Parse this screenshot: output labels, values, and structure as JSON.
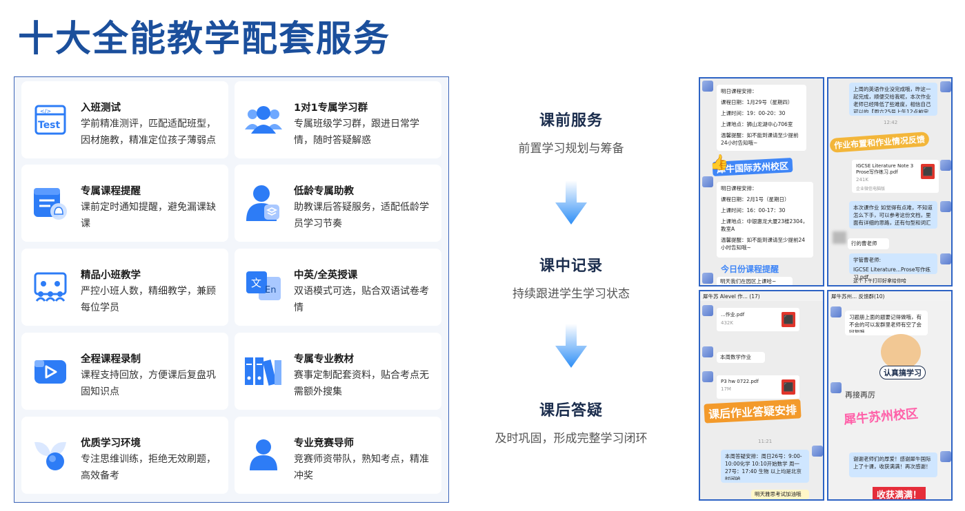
{
  "title": "十大全能教学配套服务",
  "services": [
    {
      "title": "入班测试",
      "desc": "学前精准测评，匹配适配班型，因材施教，精准定位孩子薄弱点",
      "icon": "test-icon"
    },
    {
      "title": "1对1专属学习群",
      "desc": "专属班级学习群，跟进日常学情，随时答疑解惑",
      "icon": "group-users-icon"
    },
    {
      "title": "专属课程提醒",
      "desc": "课前定时通知提醒，避免漏课缺课",
      "icon": "notification-bell-icon"
    },
    {
      "title": "低龄专属助教",
      "desc": "助教课后答疑服务，适配低龄学员学习节奏",
      "icon": "assistant-teacher-icon"
    },
    {
      "title": "精品小班教学",
      "desc": "严控小班人数，精细教学，兼顾每位学员",
      "icon": "small-class-icon"
    },
    {
      "title": "中英/全英授课",
      "desc": "双语模式可选，贴合双语试卷考情",
      "icon": "translate-icon"
    },
    {
      "title": "全程课程录制",
      "desc": "课程支持回放，方便课后复盘巩固知识点",
      "icon": "video-record-icon"
    },
    {
      "title": "专属专业教材",
      "desc": "赛事定制配套资料，贴合考点无需额外搜集",
      "icon": "books-icon"
    },
    {
      "title": "优质学习环境",
      "desc": "专注思维训练，拒绝无效刷题，高效备考",
      "icon": "environment-shape-icon"
    },
    {
      "title": "专业竞赛导师",
      "desc": "竞赛师资带队，熟知考点，精准冲奖",
      "icon": "mentor-icon"
    }
  ],
  "flow": [
    {
      "title": "课前服务",
      "sub": "前置学习规划与筹备"
    },
    {
      "title": "课中记录",
      "sub": "持续跟进学生学习状态"
    },
    {
      "title": "课后答疑",
      "sub": "及时巩固，形成完整学习闭环"
    }
  ],
  "shots": {
    "s1": {
      "schedule_head": "明日课程安排：",
      "date1": "课程日期：1月29号（星期四）",
      "time1": "上课时间：19：00-20：30",
      "place1": "上课地点：狮山龙湖中心706室",
      "tip1": "温馨提醒：如不能到课请至少提前24小时告知哦~",
      "overlay": "犀牛国际苏州校区",
      "schedule_head2": "明日课程安排：",
      "date2": "课程日期：2月1号（星期日）",
      "time2": "上课时间：16：00-17：30",
      "place2": "上课地点：中银惠龙大厦23楼2304，教室A",
      "tip2": "温馨提醒：如不能到课请至少提前24小时告知哦~",
      "overlay2": "今日份课程提醒",
      "footer": "明天我们在园区上课哈~"
    },
    "s2": {
      "msg1": "上周的英语作业没完成哦，昨这一起完成，顺便交给我呢，本次作业老师已经降低了些难度，相信自己可以的【周六25号上午12点前完成】",
      "time": "12:42",
      "overlay": "作业布置和作业情况反馈",
      "file_name": "IGCSE Literature Note 3 Prose写作练习.pdf",
      "file_size": "241K",
      "file_source": "企业微信电脑版",
      "msg2": "本次课作业 如觉得有点难，不知道怎么下手，可以参考这份文档，里面有详细的思路，还有句型和词汇",
      "name": "行的曹老师",
      "quote_label": "学管曹老师:",
      "quote_file": "IGCSE Literature...Prose写作练习.pdf",
      "footer": "这个下午打印好拿给你哈"
    },
    "s3": {
      "header": "犀牛苏 Alevel 作... (17)",
      "file1": "...作业.pdf",
      "file1_size": "432K",
      "label1": "本周数学作业",
      "file2": "P3 hw 0722.pdf",
      "file2_size": "17M",
      "overlay": "课后作业答疑安排",
      "time": "11:21",
      "schedule": "本周答疑安排：周日26号：9:00-10:00化学 10:10开始数学 周一27号：17:40 生物 以上均是北京时间哈",
      "footer": "明天雅思考试加油哦"
    },
    "s4": {
      "header": "犀牛苏州... 反馈群(10)",
      "msg1": "习题册上面的题要记得做哦，有不会的可以发群里老师有空了会回复哦",
      "sticker": "认真搞学习",
      "msg2": "再接再厉",
      "overlay": "犀牛苏州校区",
      "msg3": "谢谢老师们的厚爱！感谢犀牛国际上了十课，收获满满！再次感谢！",
      "badge": "收获满满！"
    }
  },
  "colors": {
    "title_blue": "#1b4f9c",
    "accent_blue": "#2d7cf6",
    "panel_border": "#3a63b8"
  }
}
